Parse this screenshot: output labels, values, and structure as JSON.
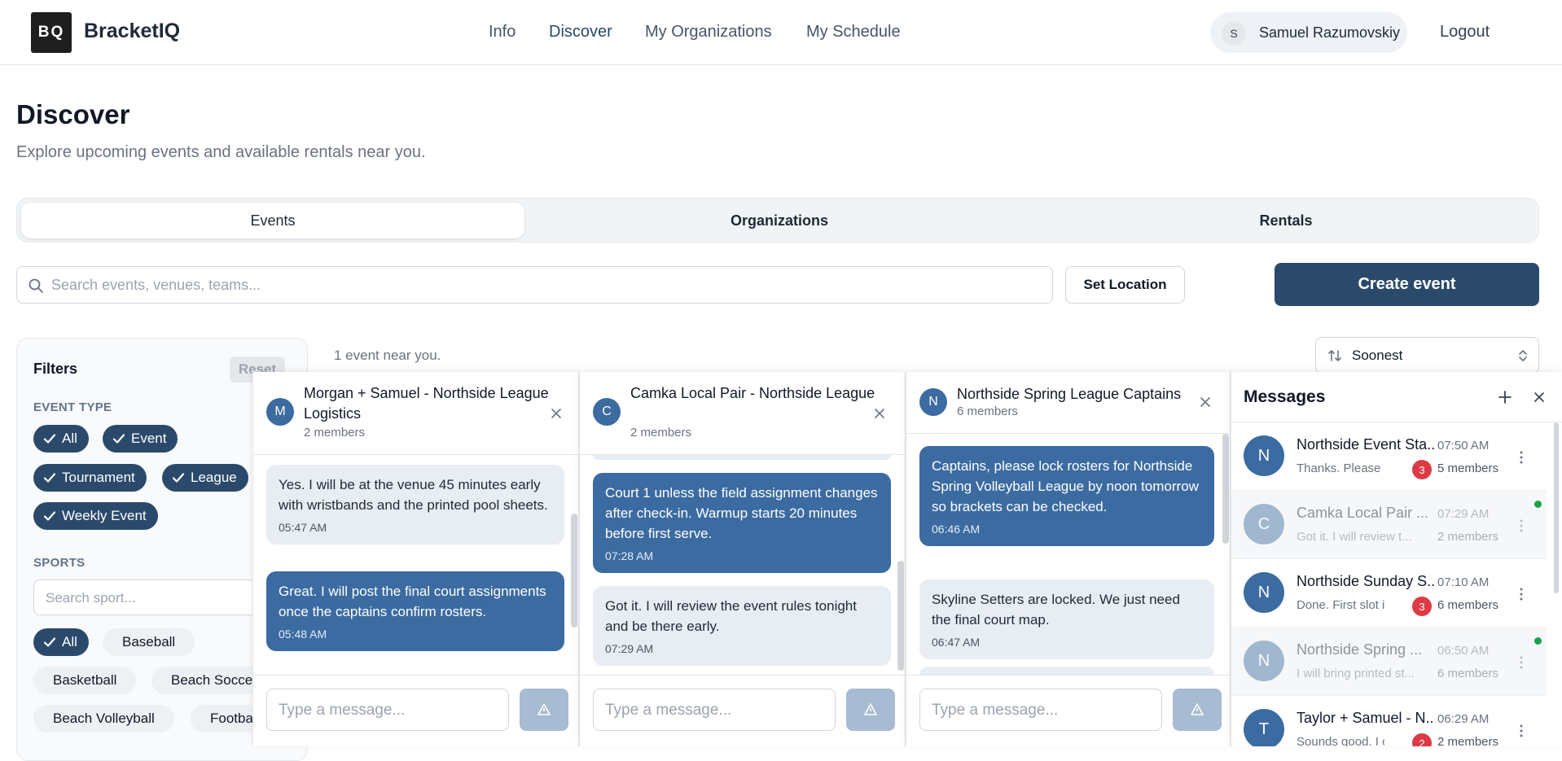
{
  "header": {
    "logo_text": "BQ",
    "brand": "BracketIQ",
    "nav": [
      "Info",
      "Discover",
      "My Organizations",
      "My Schedule"
    ],
    "active_nav": "Discover",
    "user_initial": "S",
    "user_name": "Samuel Razumovskiy",
    "logout": "Logout"
  },
  "page": {
    "title": "Discover",
    "subtitle": "Explore upcoming events and available rentals near you."
  },
  "tabs": [
    "Events",
    "Organizations",
    "Rentals"
  ],
  "active_tab": "Events",
  "search": {
    "placeholder": "Search events, venues, teams..."
  },
  "set_location": "Set Location",
  "create_event": "Create event",
  "filters": {
    "title": "Filters",
    "reset": "Reset",
    "event_type_label": "EVENT TYPE",
    "event_types": [
      "All",
      "Event",
      "Tournament",
      "League",
      "Weekly Event"
    ],
    "sports_label": "SPORTS",
    "sport_search_placeholder": "Search sport...",
    "sports": [
      "All",
      "Baseball",
      "Basketball",
      "Beach Soccer",
      "Beach Volleyball",
      "Football"
    ]
  },
  "results": {
    "count_text": "1 event near you.",
    "sort_value": "Soonest"
  },
  "chats": [
    {
      "initial": "M",
      "title": "Morgan + Samuel - Northside League Logistics",
      "members": "2 members",
      "messages": [
        {
          "text": "Yes. I will be at the venue 45 minutes early with wristbands and the printed pool sheets.",
          "time": "05:47 AM",
          "dir": "in"
        },
        {
          "text": "Great. I will post the final court assignments once the captains confirm rosters.",
          "time": "05:48 AM",
          "dir": "out"
        }
      ],
      "input_placeholder": "Type a message..."
    },
    {
      "initial": "C",
      "title": "Camka Local Pair - Northside League",
      "members": "2 members",
      "messages": [
        {
          "text": "Court 1 unless the field assignment changes after check-in. Warmup starts 20 minutes before first serve.",
          "time": "07:28 AM",
          "dir": "out"
        },
        {
          "text": "Got it. I will review the event rules tonight and be there early.",
          "time": "07:29 AM",
          "dir": "in"
        }
      ],
      "input_placeholder": "Type a message..."
    },
    {
      "initial": "N",
      "title": "Northside Spring League Captains",
      "members": "6 members",
      "messages": [
        {
          "text": "Captains, please lock rosters for Northside Spring Volleyball League by noon tomorrow so brackets can be checked.",
          "time": "06:46 AM",
          "dir": "out"
        },
        {
          "text": "Skyline Setters are locked. We just need the final court map.",
          "time": "06:47 AM",
          "dir": "in"
        }
      ],
      "input_placeholder": "Type a message..."
    }
  ],
  "messages_panel": {
    "title": "Messages",
    "conversations": [
      {
        "initial": "N",
        "name": "Northside Event Sta...",
        "time": "07:50 AM",
        "preview": "Thanks. Please p...",
        "unread": "3",
        "members": "5 members",
        "dim": false,
        "online": false
      },
      {
        "initial": "C",
        "name": "Camka Local Pair ...",
        "time": "07:29 AM",
        "preview": "Got it. I will review t...",
        "unread": "",
        "members": "2 members",
        "dim": true,
        "online": true
      },
      {
        "initial": "N",
        "name": "Northside Sunday S...",
        "time": "07:10 AM",
        "preview": "Done. First slot is...",
        "unread": "3",
        "members": "6 members",
        "dim": false,
        "online": false
      },
      {
        "initial": "N",
        "name": "Northside Spring ...",
        "time": "06:50 AM",
        "preview": "I will bring printed st...",
        "unread": "",
        "members": "6 members",
        "dim": true,
        "online": true
      },
      {
        "initial": "T",
        "name": "Taylor + Samuel - N...",
        "time": "06:29 AM",
        "preview": "Sounds good. I c...",
        "unread": "2",
        "members": "2 members",
        "dim": false,
        "online": false
      }
    ]
  },
  "colors": {
    "primary": "#2b4a6b",
    "bubble_out": "#3b6ba0",
    "bubble_in": "#e8edf3",
    "badge": "#dc3b45",
    "online": "#16a34a"
  }
}
